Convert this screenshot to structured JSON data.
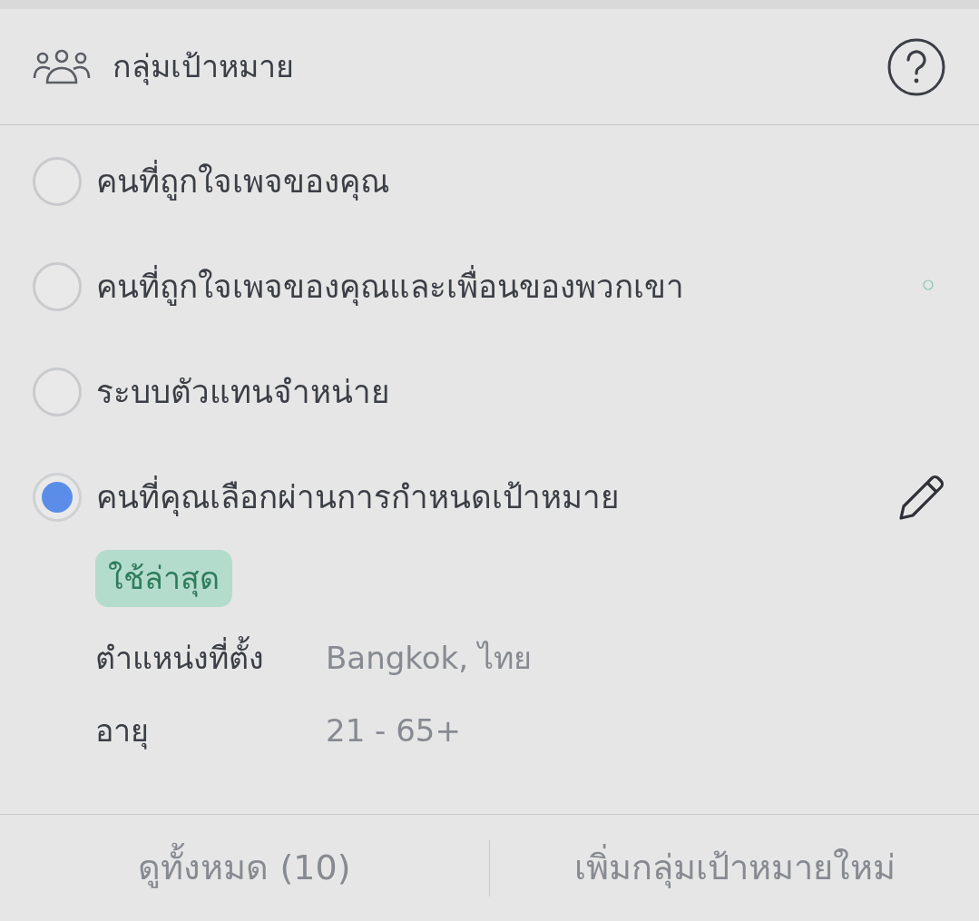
{
  "header": {
    "title": "กลุ่มเป้าหมาย"
  },
  "options": [
    {
      "label": "คนที่ถูกใจเพจของคุณ",
      "selected": false
    },
    {
      "label": "คนที่ถูกใจเพจของคุณและเพื่อนของพวกเขา",
      "selected": false
    },
    {
      "label": "ระบบตัวแทนจำหน่าย",
      "selected": false
    },
    {
      "label": "คนที่คุณเลือกผ่านการกำหนดเป้าหมาย",
      "selected": true,
      "editable": true
    }
  ],
  "selected_details": {
    "badge": "ใช้ล่าสุด",
    "fields": [
      {
        "label": "ตำแหน่งที่ตั้ง",
        "value": "Bangkok, ไทย"
      },
      {
        "label": "อายุ",
        "value": "21 - 65+"
      }
    ]
  },
  "footer": {
    "buttons": [
      "ดูทั้งหมด (10)",
      "เพิ่มกลุ่มเป้าหมายใหม่"
    ]
  }
}
